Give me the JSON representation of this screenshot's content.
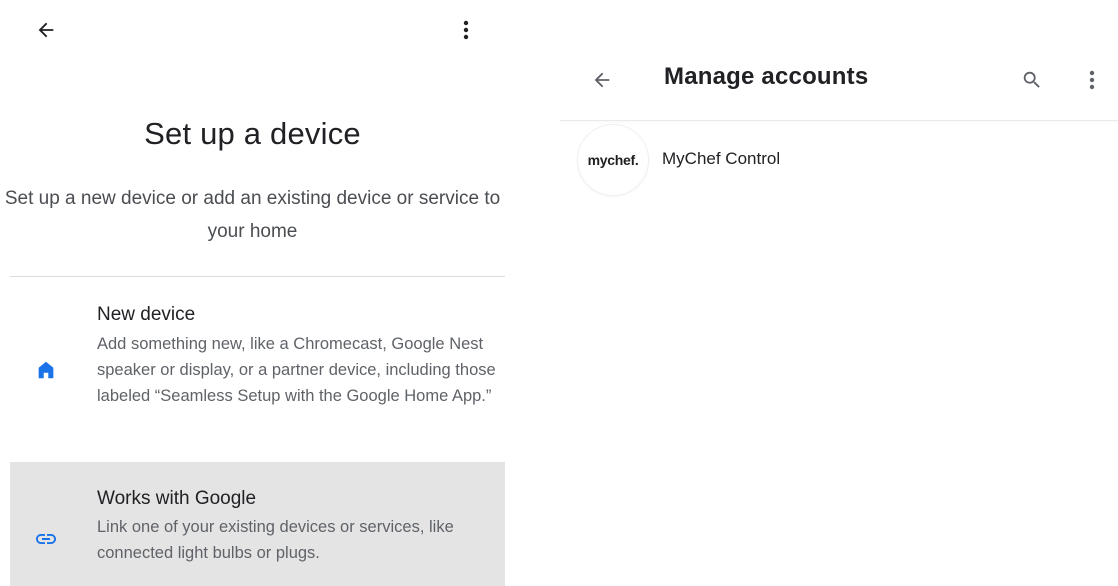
{
  "setup_screen": {
    "title": "Set up a device",
    "subtitle": "Set up a new device or add an existing device or service to your home",
    "options": [
      {
        "title": "New device",
        "description": "Add something new, like a Chromecast, Google Nest speaker or display, or a partner device, including those labeled “Seamless Setup with the Google Home App.”",
        "icon": "home-icon"
      },
      {
        "title": "Works with Google",
        "description": "Link one of your existing devices or services, like connected light bulbs or plugs.",
        "icon": "link-icon"
      }
    ]
  },
  "manage_screen": {
    "title": "Manage accounts",
    "accounts": [
      {
        "logo_text": "mychef.",
        "name": "MyChef Control"
      }
    ]
  },
  "colors": {
    "accent_blue": "#1a73e8",
    "selected_row_bg": "#e4e4e4",
    "text_primary": "#202124",
    "text_secondary": "#5f6368"
  }
}
